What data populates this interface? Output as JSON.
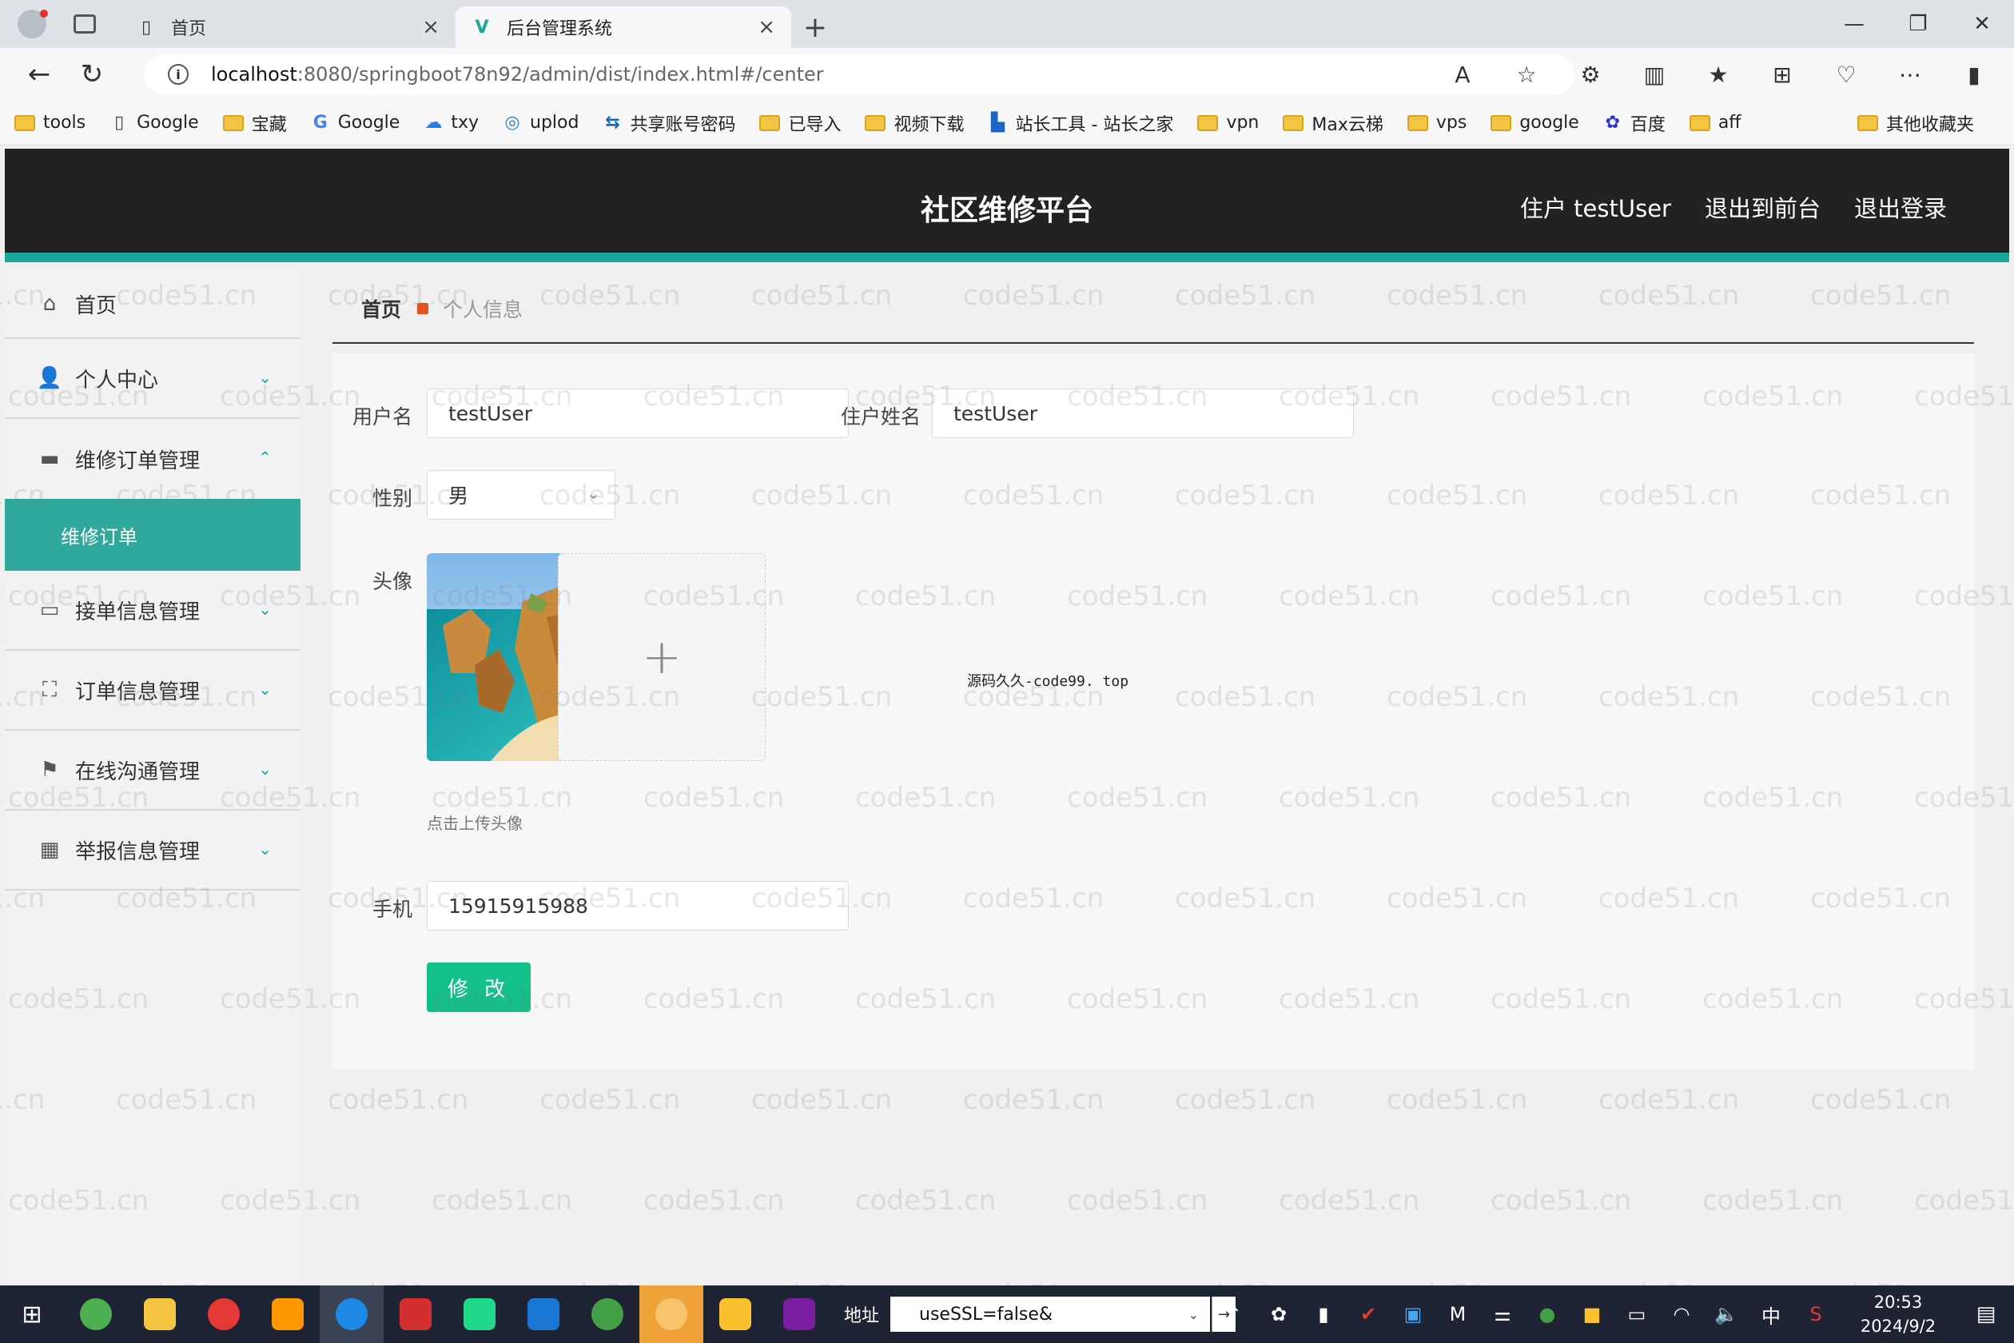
{
  "browser": {
    "tabs": [
      {
        "title": "首页",
        "active": false
      },
      {
        "title": "后台管理系统",
        "active": true
      }
    ],
    "url_host": "localhost",
    "url_path": ":8080/springboot78n92/admin/dist/index.html#/center",
    "bookmarks": [
      "tools",
      "Google",
      "宝藏",
      "Google",
      "txy",
      "uplod",
      "共享账号密码",
      "已导入",
      "视频下载",
      "站长工具 - 站长之家",
      "vpn",
      "Max云梯",
      "vps",
      "google",
      "百度",
      "aff"
    ],
    "other_bookmarks": "其他收藏夹"
  },
  "header": {
    "title": "社区维修平台",
    "user": "住户 testUser",
    "back_front": "退出到前台",
    "logout": "退出登录"
  },
  "sidebar": {
    "items": [
      {
        "label": "首页",
        "icon": "home-icon"
      },
      {
        "label": "个人中心",
        "icon": "user-icon"
      },
      {
        "label": "维修订单管理",
        "icon": "chat-icon",
        "expanded": true,
        "sub": "维修订单"
      },
      {
        "label": "接单信息管理",
        "icon": "monitor-icon"
      },
      {
        "label": "订单信息管理",
        "icon": "frame-icon"
      },
      {
        "label": "在线沟通管理",
        "icon": "flag-icon"
      },
      {
        "label": "举报信息管理",
        "icon": "grid-icon"
      }
    ]
  },
  "breadcrumb": {
    "home": "首页",
    "current": "个人信息"
  },
  "form": {
    "username_label": "用户名",
    "username": "testUser",
    "name_label": "住户姓名",
    "name": "testUser",
    "gender_label": "性别",
    "gender": "男",
    "avatar_label": "头像",
    "avatar_tip": "点击上传头像",
    "upload_plus": "+",
    "source_note": "源码久久-code99. top",
    "phone_label": "手机",
    "phone": "15915915988",
    "submit": "修 改"
  },
  "watermark": "code51.cn",
  "taskbar": {
    "addr_label": "地址",
    "addr_value": "useSSL=false&",
    "time": "20:53",
    "date": "2024/9/2",
    "ime": "中"
  },
  "colors": {
    "accent": "#1aa79b",
    "header_bg": "#222222",
    "submit_btn": "#13c08a",
    "sidebar_active": "#2ea99b"
  }
}
